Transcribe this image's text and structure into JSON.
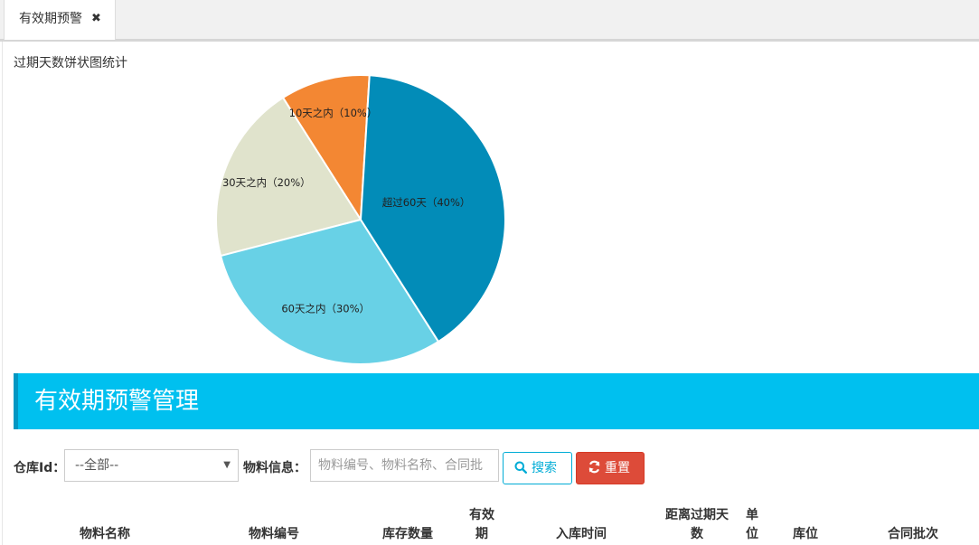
{
  "tabs": [
    {
      "label": "有效期预警",
      "close_icon": "✖"
    }
  ],
  "chart": {
    "title": "过期天数饼状图统计",
    "colors": [
      "#f38733",
      "#e0e3cc",
      "#68d1e6",
      "#028cb8"
    ]
  },
  "chart_data": {
    "type": "pie",
    "title": "过期天数饼状图统计",
    "slices": [
      {
        "label": "10天之内（10%）",
        "value": 10
      },
      {
        "label": "30天之内（20%）",
        "value": 20
      },
      {
        "label": "60天之内（30%）",
        "value": 30
      },
      {
        "label": "超过60天（40%）",
        "value": 40
      }
    ]
  },
  "panel": {
    "title": "有效期预警管理"
  },
  "filters": {
    "warehouse_label": "仓库Id：",
    "warehouse_selected": "--全部--",
    "material_label": "物料信息：",
    "material_placeholder": "物料编号、物料名称、合同批",
    "search_label": "搜索",
    "reset_label": "重置"
  },
  "table": {
    "headers": {
      "name": "物料名称",
      "code": "物料编号",
      "stock": "库存数量",
      "validity_line1": "有效",
      "validity_line2": "期",
      "inbound": "入库时间",
      "days_line1": "距离过期天",
      "days_line2": "数",
      "unit_line1": "单",
      "unit_line2": "位",
      "location": "库位",
      "contract_batch": "合同批次"
    }
  }
}
